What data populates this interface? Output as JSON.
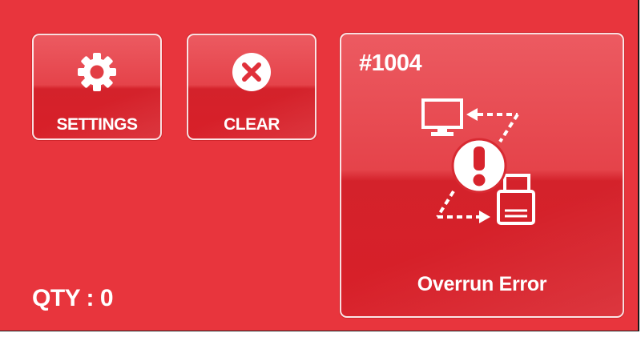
{
  "theme": {
    "background": "#e8353d",
    "tile_border": "#ffffff",
    "text": "#ffffff"
  },
  "buttons": {
    "settings": {
      "label": "SETTINGS",
      "icon": "gear-icon"
    },
    "clear": {
      "label": "CLEAR",
      "icon": "close-circle-icon"
    }
  },
  "status": {
    "qty_label": "QTY",
    "qty_separator": " : ",
    "qty_value": "0"
  },
  "error": {
    "code": "#1004",
    "title": "Overrun Error",
    "icon": "overrun-error-icon"
  }
}
